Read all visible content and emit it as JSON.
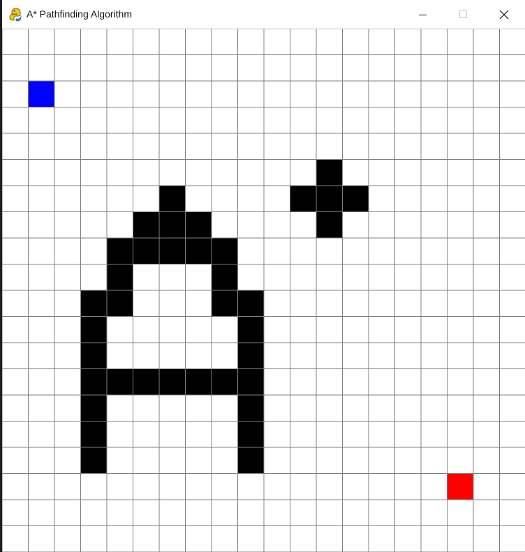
{
  "window": {
    "title": "A* Pathfinding Algorithm",
    "icons": {
      "app": "python-snake-icon",
      "minimize": "minimize-icon",
      "maximize": "maximize-icon",
      "close": "close-icon"
    }
  },
  "grid": {
    "rows": 20,
    "cols": 20,
    "colors": {
      "empty": "#ffffff",
      "barrier": "#000000",
      "start": "#0000ff",
      "end": "#ff0000",
      "line": "#808080"
    },
    "start": {
      "row": 2,
      "col": 1
    },
    "end": {
      "row": 17,
      "col": 17
    },
    "barriers": [
      [
        5,
        12
      ],
      [
        6,
        6
      ],
      [
        6,
        11
      ],
      [
        6,
        12
      ],
      [
        6,
        13
      ],
      [
        7,
        5
      ],
      [
        7,
        6
      ],
      [
        7,
        7
      ],
      [
        7,
        12
      ],
      [
        8,
        4
      ],
      [
        8,
        5
      ],
      [
        8,
        6
      ],
      [
        8,
        7
      ],
      [
        8,
        8
      ],
      [
        9,
        4
      ],
      [
        9,
        8
      ],
      [
        10,
        3
      ],
      [
        10,
        4
      ],
      [
        10,
        8
      ],
      [
        10,
        9
      ],
      [
        11,
        3
      ],
      [
        11,
        9
      ],
      [
        12,
        3
      ],
      [
        12,
        9
      ],
      [
        13,
        3
      ],
      [
        13,
        4
      ],
      [
        13,
        5
      ],
      [
        13,
        6
      ],
      [
        13,
        7
      ],
      [
        13,
        8
      ],
      [
        13,
        9
      ],
      [
        14,
        3
      ],
      [
        14,
        9
      ],
      [
        15,
        3
      ],
      [
        15,
        9
      ],
      [
        16,
        3
      ],
      [
        16,
        9
      ]
    ]
  }
}
